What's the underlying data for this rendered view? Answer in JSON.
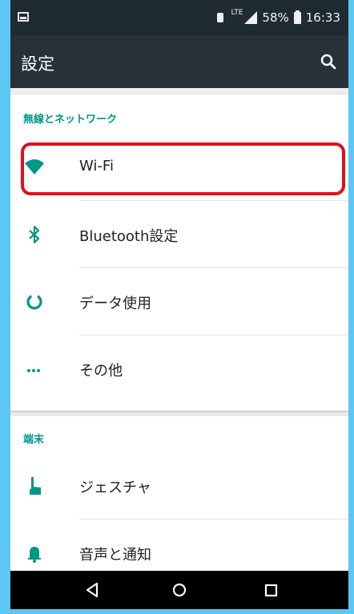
{
  "status_bar": {
    "signal_badge": "LTE",
    "battery": "58%",
    "time": "16:33"
  },
  "app_bar": {
    "title": "設定"
  },
  "sections": [
    {
      "header": "無線とネットワーク",
      "items": [
        {
          "label": "Wi-Fi",
          "icon": "wifi-icon"
        },
        {
          "label": "Bluetooth設定",
          "icon": "bluetooth-icon"
        },
        {
          "label": "データ使用",
          "icon": "data-usage-icon"
        },
        {
          "label": "その他",
          "icon": "more-icon"
        }
      ]
    },
    {
      "header": "端末",
      "items": [
        {
          "label": "ジェスチャ",
          "icon": "gesture-icon"
        },
        {
          "label": "音声と通知",
          "icon": "bell-icon"
        }
      ]
    }
  ],
  "colors": {
    "accent": "#009688",
    "app_bar": "#263238",
    "status_bar": "#1f2b33",
    "highlight": "#e0101a",
    "outer_frame": "#5cc7f3"
  }
}
